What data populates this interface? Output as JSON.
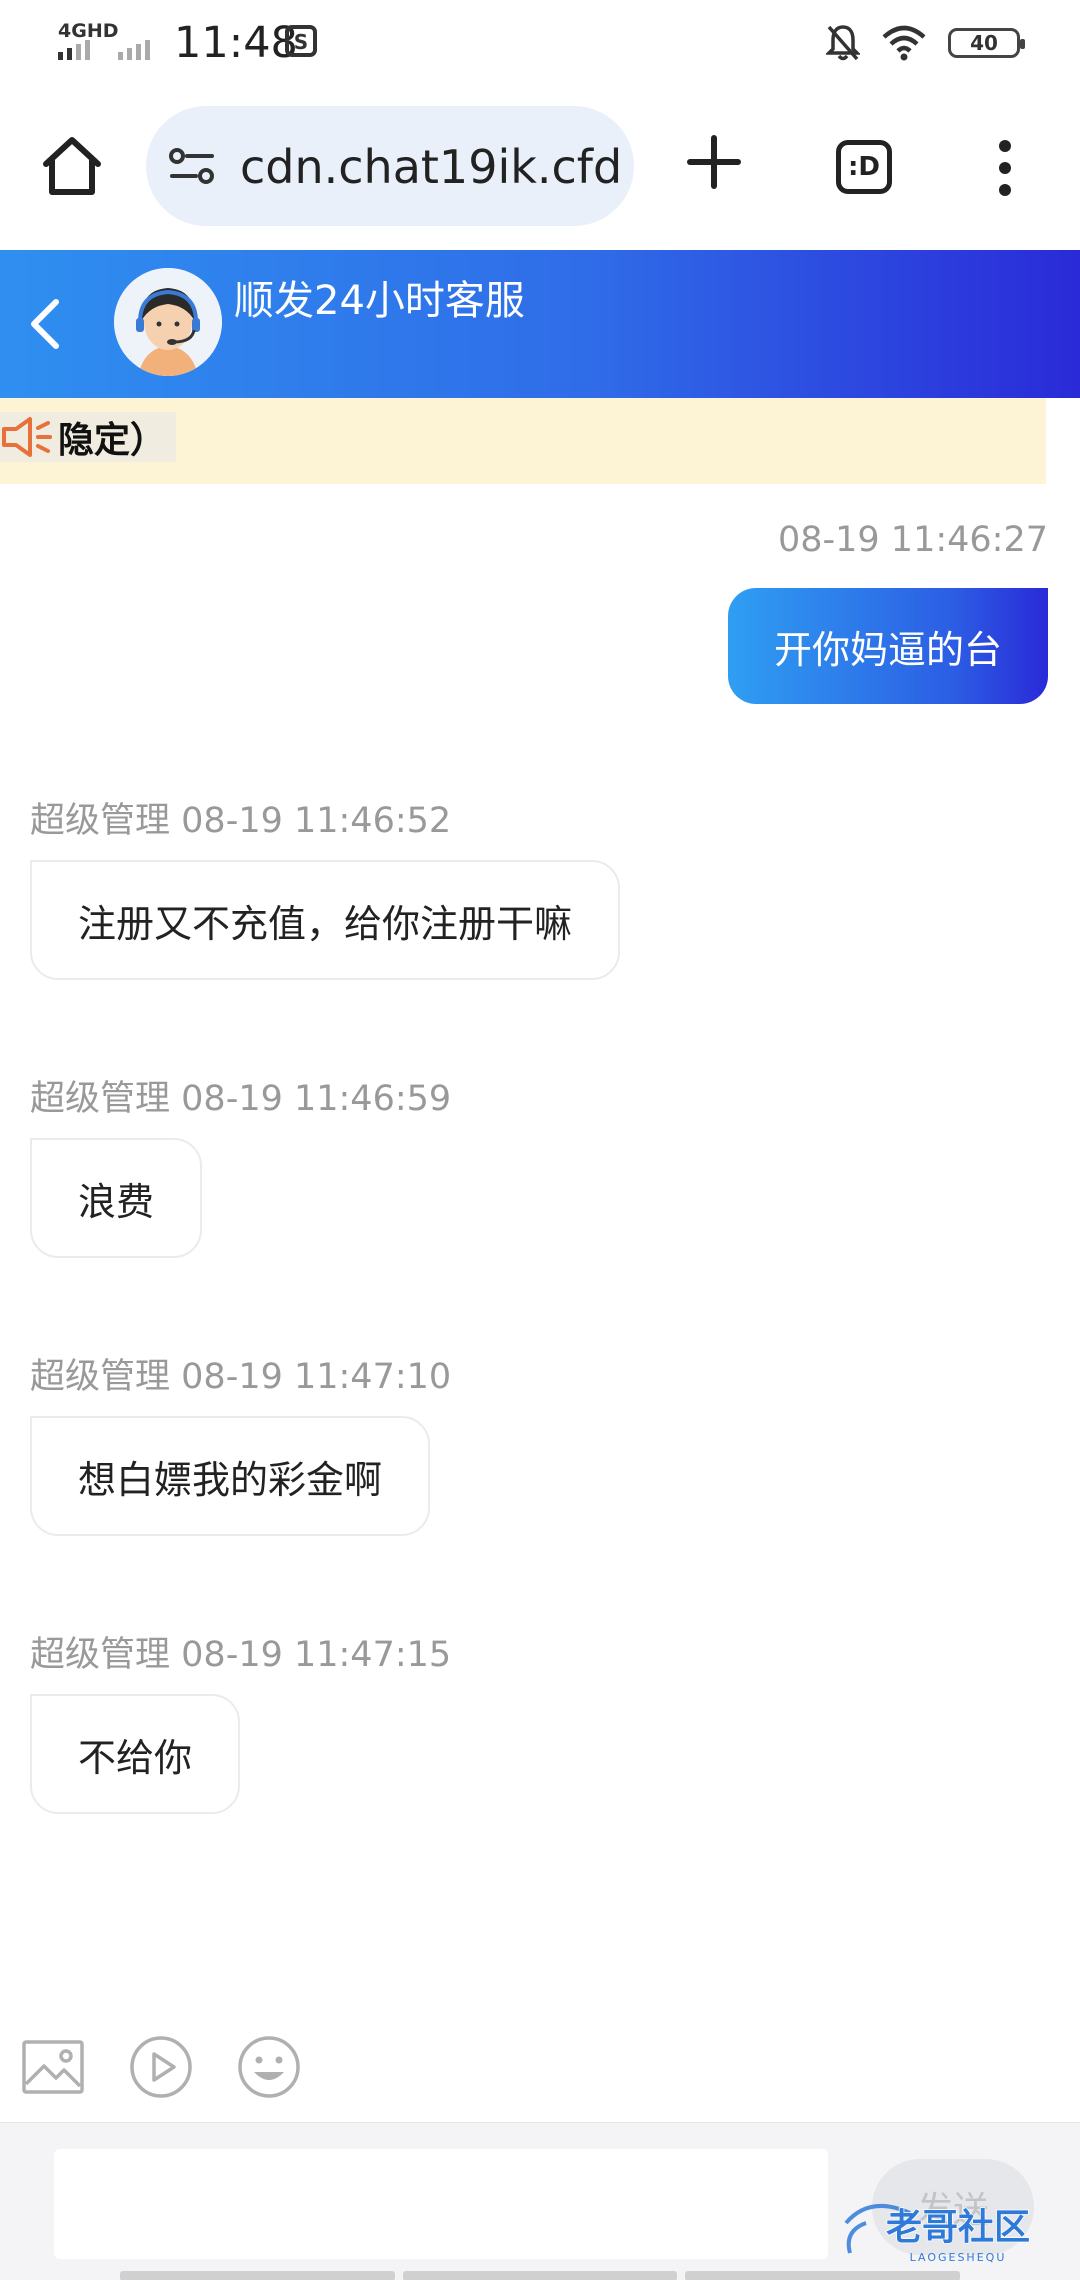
{
  "status_bar": {
    "network": "4GHD",
    "time": "11:48",
    "battery": "40"
  },
  "browser": {
    "url": "cdn.chat19ik.cfd",
    "tabs_label": ":D"
  },
  "chat_header": {
    "agent_name": "顺发24小时客服"
  },
  "notice": {
    "text": "隐定）"
  },
  "messages": {
    "outgoing": {
      "timestamp": "08-19 11:46:27",
      "text": "开你妈逼的台"
    },
    "incoming": [
      {
        "sender": "超级管理",
        "timestamp": "08-19 11:46:52",
        "text": "注册又不充值，给你注册干嘛"
      },
      {
        "sender": "超级管理",
        "timestamp": "08-19 11:46:59",
        "text": "浪费"
      },
      {
        "sender": "超级管理",
        "timestamp": "08-19 11:47:10",
        "text": "想白嫖我的彩金啊"
      },
      {
        "sender": "超级管理",
        "timestamp": "08-19 11:47:15",
        "text": "不给你"
      }
    ]
  },
  "input": {
    "placeholder": "",
    "send_label": "发送"
  },
  "watermark": {
    "text": "老哥社区",
    "sub": "LAOGESHEQU"
  },
  "colors": {
    "header_gradient_start": "#2f8ff0",
    "header_gradient_end": "#2a2ad8",
    "notice_bg": "#fdf4d6",
    "timestamp_gray": "#999999"
  }
}
